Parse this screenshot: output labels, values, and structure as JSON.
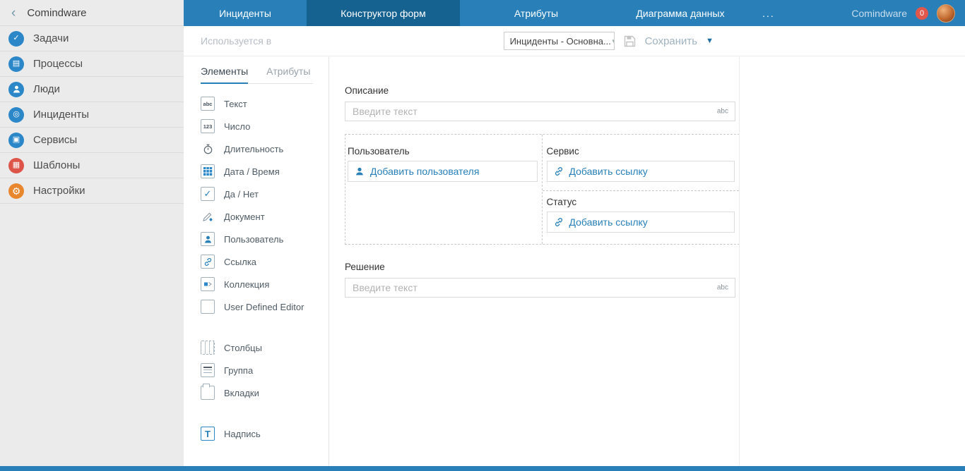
{
  "colors": {
    "topbar_blue": "#2980b9",
    "active_tab_blue": "#15618f",
    "sidebar_icon_blue": "#2b87c8",
    "templates_red": "#dd5449",
    "settings_orange": "#e8872e",
    "badge_red": "#e2574c",
    "link_blue": "#2980b9"
  },
  "sidebar": {
    "title": "Comindware",
    "back_icon": "‹",
    "items": [
      {
        "label": "Задачи",
        "icon": "tasks-icon",
        "glyph": "✓"
      },
      {
        "label": "Процессы",
        "icon": "processes-icon",
        "glyph": "▤"
      },
      {
        "label": "Люди",
        "icon": "people-icon"
      },
      {
        "label": "Инциденты",
        "icon": "incidents-icon",
        "glyph": "◎"
      },
      {
        "label": "Сервисы",
        "icon": "services-icon",
        "glyph": "▣"
      },
      {
        "label": "Шаблоны",
        "icon": "templates-icon",
        "glyph": "▦"
      },
      {
        "label": "Настройки",
        "icon": "settings-icon",
        "glyph": "⚙"
      }
    ]
  },
  "topbar": {
    "tabs": [
      {
        "label": "Инциденты",
        "active": false
      },
      {
        "label": "Конструктор форм",
        "active": true
      },
      {
        "label": "Атрибуты",
        "active": false
      },
      {
        "label": "Диаграмма данных",
        "active": false
      },
      {
        "label": "...",
        "active": false
      }
    ],
    "brand": "Comindware",
    "badge_count": "0"
  },
  "toolbar": {
    "used_in": "Используется в",
    "form_selector_value": "Инциденты - Основна...",
    "save": "Сохранить"
  },
  "palette": {
    "tabs": [
      {
        "label": "Элементы",
        "active": true
      },
      {
        "label": "Атрибуты",
        "active": false
      }
    ],
    "items": [
      {
        "label": "Текст",
        "icon": "text-abc-icon",
        "icon_text": "abc"
      },
      {
        "label": "Число",
        "icon": "number-123-icon",
        "icon_text": "123"
      },
      {
        "label": "Длительность",
        "icon": "stopwatch-icon"
      },
      {
        "label": "Дата / Время",
        "icon": "calendar-icon"
      },
      {
        "label": "Да / Нет",
        "icon": "checkbox-icon",
        "glyph": "✓"
      },
      {
        "label": "Документ",
        "icon": "document-icon"
      },
      {
        "label": "Пользователь",
        "icon": "user-icon"
      },
      {
        "label": "Ссылка",
        "icon": "link-icon"
      },
      {
        "label": "Коллекция",
        "icon": "collection-icon"
      },
      {
        "label": "User Defined Editor",
        "icon": "blank-editor-icon"
      }
    ],
    "layout_items": [
      {
        "label": "Столбцы",
        "icon": "columns-icon"
      },
      {
        "label": "Группа",
        "icon": "group-icon"
      },
      {
        "label": "Вкладки",
        "icon": "tabs-icon"
      }
    ],
    "misc_items": [
      {
        "label": "Надпись",
        "icon": "label-t-icon",
        "icon_text": "T"
      }
    ]
  },
  "canvas": {
    "description": {
      "label": "Описание",
      "placeholder": "Введите текст",
      "type_hint": "abc"
    },
    "user_field": {
      "label": "Пользователь",
      "action": "Добавить пользователя"
    },
    "service_field": {
      "label": "Сервис",
      "action": "Добавить ссылку"
    },
    "status_field": {
      "label": "Статус",
      "action": "Добавить ссылку"
    },
    "solution": {
      "label": "Решение",
      "placeholder": "Введите текст",
      "type_hint": "abc"
    }
  }
}
